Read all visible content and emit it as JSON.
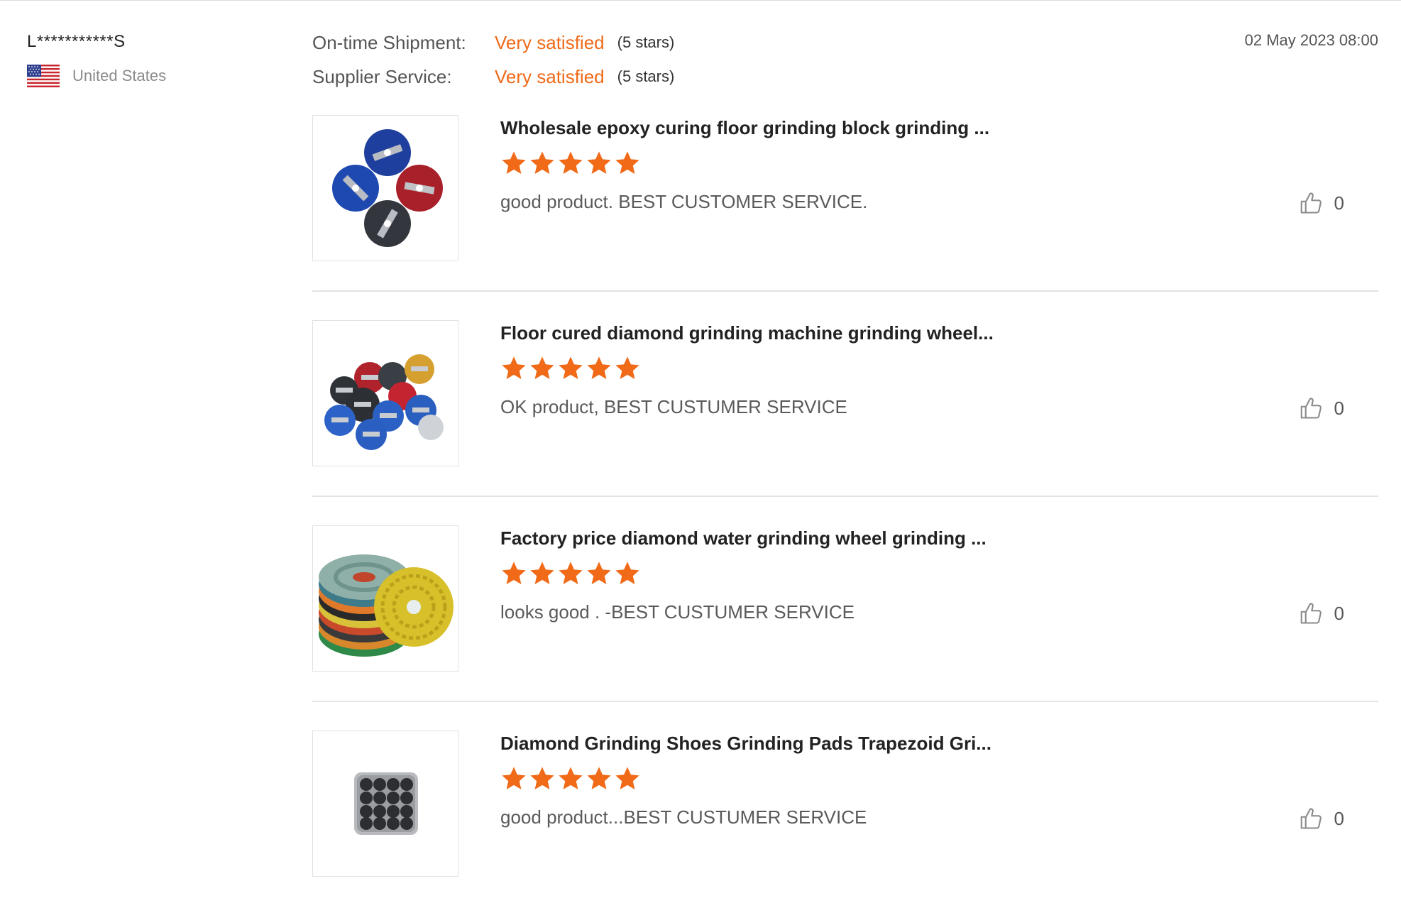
{
  "reviewer": {
    "name": "L***********S",
    "country": "United States",
    "flag_icon": "us-flag-icon"
  },
  "ratings": [
    {
      "label": "On-time Shipment:",
      "value": "Very satisfied",
      "stars_text": "(5 stars)"
    },
    {
      "label": "Supplier Service:",
      "value": "Very satisfied",
      "stars_text": "(5 stars)"
    }
  ],
  "review_date": "02 May 2023 08:00",
  "colors": {
    "accent": "#f06a18",
    "text": "#333333",
    "muted": "#8b8b8b",
    "divider": "#e3e3e3"
  },
  "product_reviews": [
    {
      "title": "Wholesale epoxy curing floor grinding block grinding ...",
      "rating": 5,
      "comment": "good product. BEST CUSTOMER SERVICE.",
      "likes": "0",
      "image": "grinding-disc-set-4-colors"
    },
    {
      "title": "Floor cured diamond grinding machine grinding wheel...",
      "rating": 5,
      "comment": "OK product, BEST CUSTUMER SERVICE",
      "likes": "0",
      "image": "grinding-disc-assortment"
    },
    {
      "title": "Factory price diamond water grinding wheel grinding ...",
      "rating": 5,
      "comment": "looks good . -BEST CUSTUMER SERVICE",
      "likes": "0",
      "image": "polishing-pads-stack"
    },
    {
      "title": "Diamond Grinding Shoes Grinding Pads Trapezoid Gri...",
      "rating": 5,
      "comment": "good product...BEST CUSTUMER SERVICE",
      "likes": "0",
      "image": "grinding-pads-tray"
    }
  ]
}
